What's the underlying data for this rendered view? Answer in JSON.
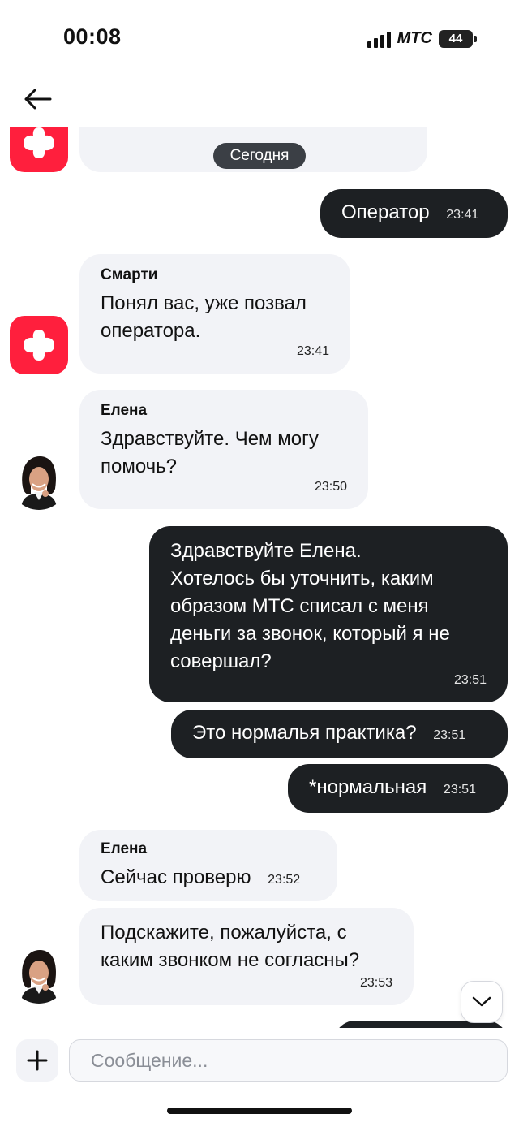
{
  "status": {
    "time": "00:08",
    "carrier": "MTC",
    "battery": "44"
  },
  "header": {
    "back_icon": "arrow-left-icon"
  },
  "date_divider": "Сегодня",
  "messages": [
    {
      "direction": "in",
      "sender": "",
      "text": "",
      "time": ""
    },
    {
      "direction": "out",
      "sender": "",
      "text": "Оператор",
      "time": "23:41"
    },
    {
      "direction": "in",
      "sender": "Смарти",
      "text": "Понял вас, уже позвал\nоператора.",
      "time": "23:41"
    },
    {
      "direction": "in",
      "sender": "Елена",
      "text": "Здравствуйте. Чем могу\nпомочь?",
      "time": "23:50"
    },
    {
      "direction": "out",
      "sender": "",
      "text": "Здравствуйте Елена.\nХотелось бы уточнить, каким\nобразом МТС списал с меня\nденьги за звонок, который я не\nсовершал?",
      "time": "23:51"
    },
    {
      "direction": "out",
      "sender": "",
      "text": "Это нормалья практика?",
      "time": "23:51"
    },
    {
      "direction": "out",
      "sender": "",
      "text": "*нормальная",
      "time": "23:51"
    },
    {
      "direction": "in",
      "sender": "Елена",
      "text": "Сейчас проверю",
      "time": "23:52"
    },
    {
      "direction": "in",
      "sender": "",
      "text": "Подскажите, пожалуйста, с\nкаким звонком не согласны?",
      "time": "23:53"
    }
  ],
  "scroll_down_icon": "chevron-down-icon",
  "composer": {
    "placeholder": "Сообщение...",
    "value": "",
    "attach_icon": "plus-icon"
  },
  "colors": {
    "outgoing_bubble": "#1d2023",
    "incoming_bubble": "#f2f3f7",
    "brand_red": "#ff1f3d"
  }
}
